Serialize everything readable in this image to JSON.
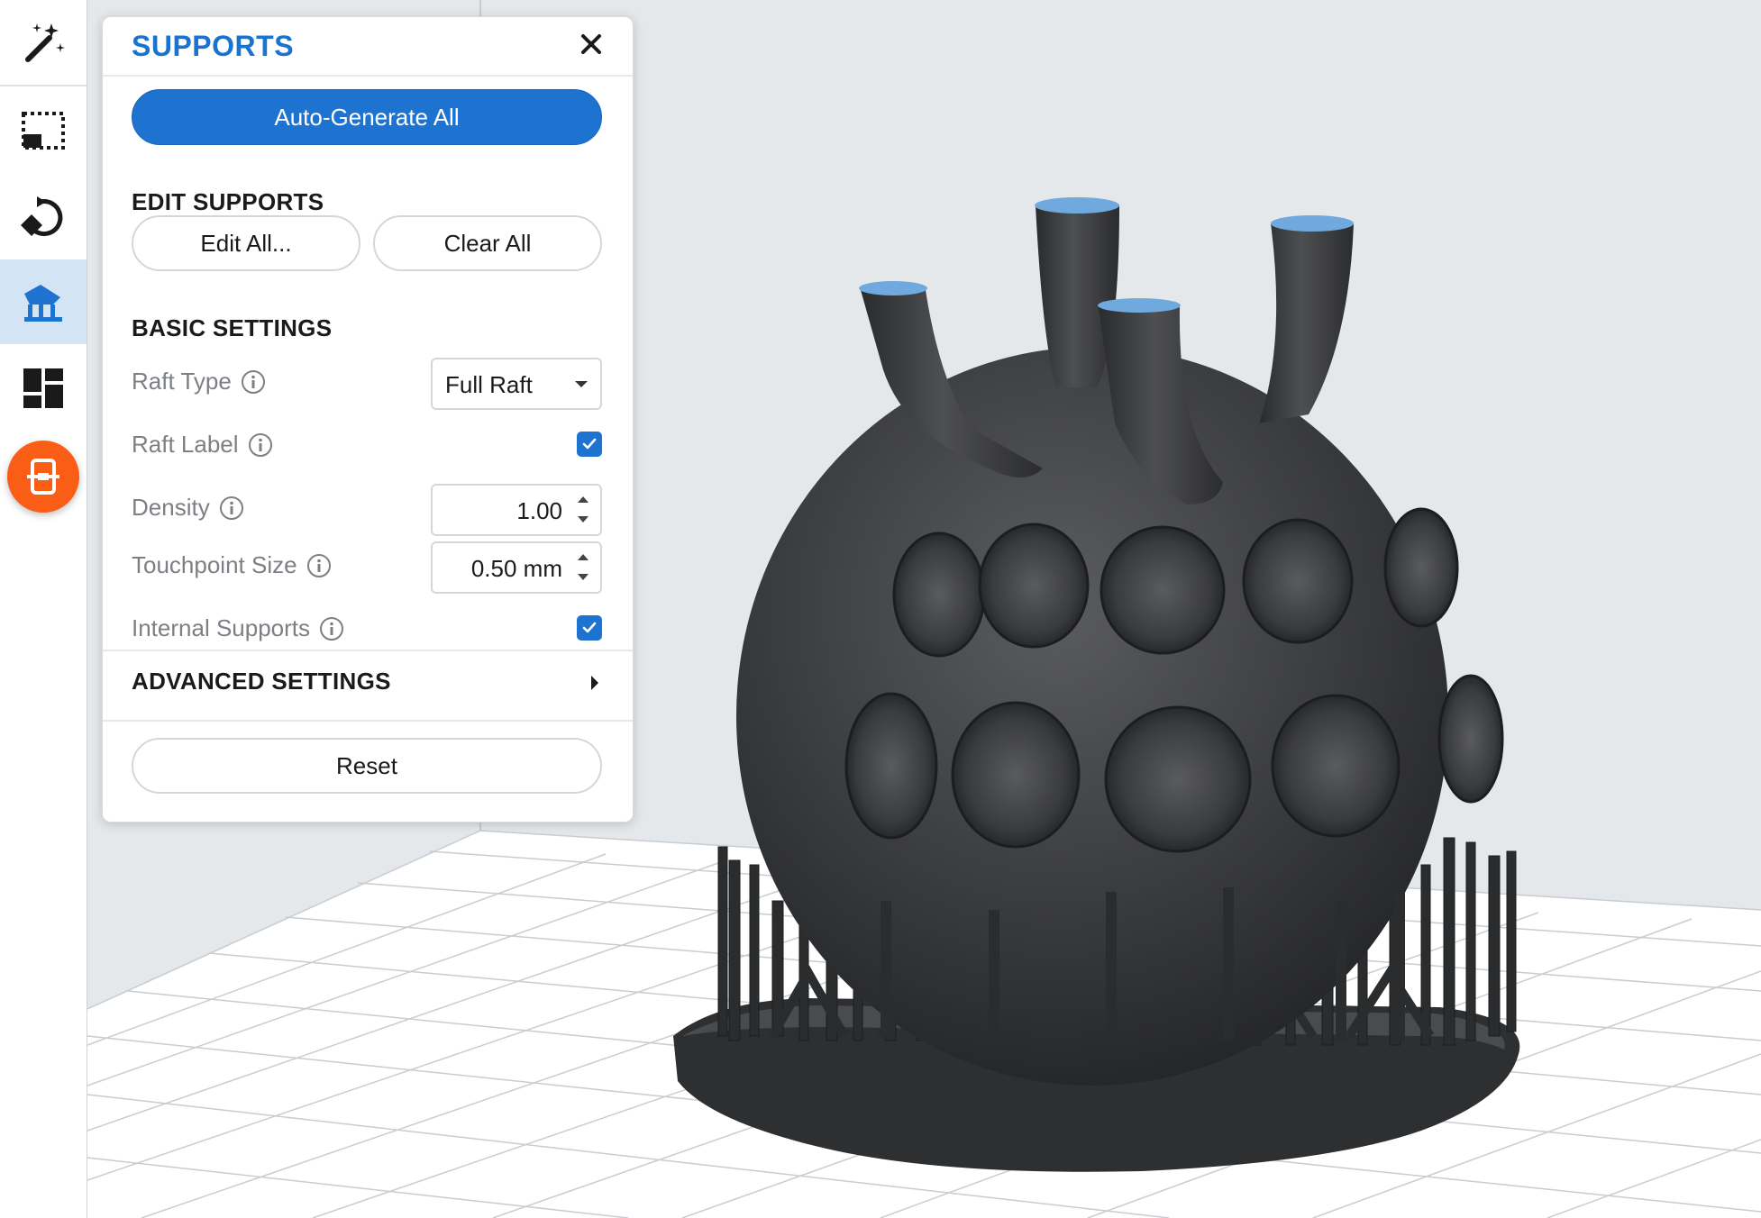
{
  "toolbar": {
    "items": [
      {
        "icon": "magic-wand-icon"
      },
      {
        "icon": "layout-crop-icon"
      },
      {
        "icon": "orient-rotate-icon"
      },
      {
        "icon": "supports-icon",
        "active": true
      },
      {
        "icon": "layout-grid-icon"
      },
      {
        "icon": "printer-icon",
        "accent": "#fa5e16"
      }
    ]
  },
  "panel": {
    "title": "SUPPORTS",
    "auto_generate_label": "Auto-Generate All",
    "edit_supports": {
      "title": "EDIT SUPPORTS",
      "edit_all_label": "Edit All...",
      "clear_all_label": "Clear All"
    },
    "basic_settings": {
      "title": "BASIC SETTINGS",
      "raft_type": {
        "label": "Raft Type",
        "value": "Full Raft"
      },
      "raft_label": {
        "label": "Raft Label",
        "checked": true
      },
      "density": {
        "label": "Density",
        "value": "1.00"
      },
      "touchpoint_size": {
        "label": "Touchpoint Size",
        "value": "0.50 mm"
      },
      "internal_supports": {
        "label": "Internal Supports",
        "checked": true
      }
    },
    "advanced_settings": {
      "title": "ADVANCED SETTINGS"
    },
    "reset_label": "Reset"
  },
  "colors": {
    "accent": "#1e73d0",
    "active_tool_bg": "#d3e5f5",
    "printer_button": "#fa5e16",
    "model": "#3a3b3d",
    "cut_face": "#6fa9de"
  }
}
